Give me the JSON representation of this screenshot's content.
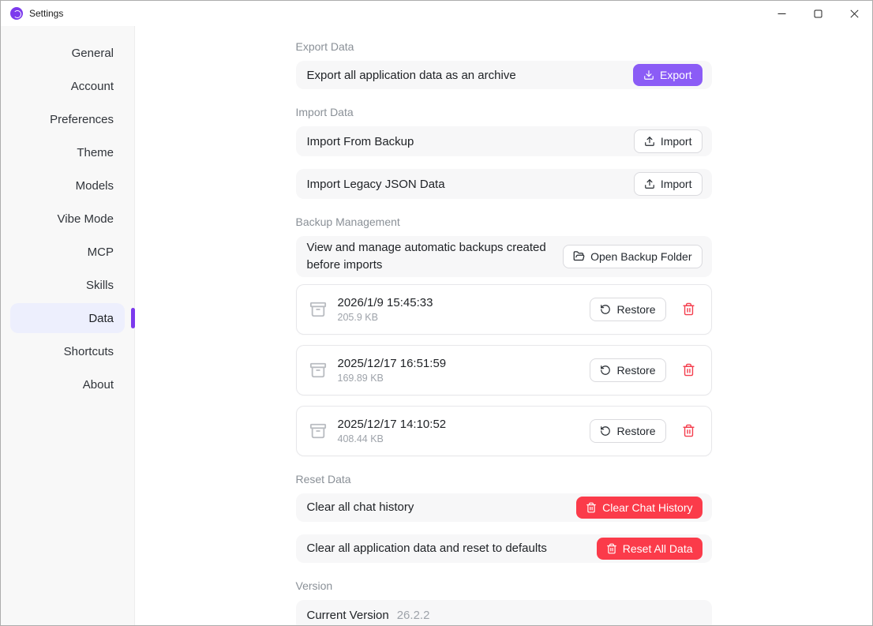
{
  "window": {
    "title": "Settings",
    "controls": {
      "minimize": "minimize",
      "maximize": "maximize",
      "close": "close"
    }
  },
  "colors": {
    "accent_purple": "#8b5cf6",
    "sidebar_accent": "#7c3aed",
    "danger_red": "#fb3b4a",
    "selected_item_bg": "#edeffd"
  },
  "sidebar": {
    "items": [
      {
        "label": "General"
      },
      {
        "label": "Account"
      },
      {
        "label": "Preferences"
      },
      {
        "label": "Theme"
      },
      {
        "label": "Models"
      },
      {
        "label": "Vibe Mode"
      },
      {
        "label": "MCP"
      },
      {
        "label": "Skills"
      },
      {
        "label": "Data"
      },
      {
        "label": "Shortcuts"
      },
      {
        "label": "About"
      }
    ],
    "selected": "Data"
  },
  "sections": {
    "export": {
      "heading": "Export Data",
      "row_label": "Export all application data as an archive",
      "button": "Export"
    },
    "import": {
      "heading": "Import Data",
      "rows": [
        {
          "label": "Import From Backup",
          "button": "Import"
        },
        {
          "label": "Import Legacy JSON Data",
          "button": "Import"
        }
      ]
    },
    "backup": {
      "heading": "Backup Management",
      "description": "View and manage automatic backups created before imports",
      "folder_button": "Open Backup Folder",
      "items": [
        {
          "date": "2026/1/9 15:45:33",
          "size": "205.9 KB",
          "restore": "Restore"
        },
        {
          "date": "2025/12/17 16:51:59",
          "size": "169.89 KB",
          "restore": "Restore"
        },
        {
          "date": "2025/12/17 14:10:52",
          "size": "408.44 KB",
          "restore": "Restore"
        }
      ]
    },
    "reset": {
      "heading": "Reset Data",
      "rows": [
        {
          "label": "Clear all chat history",
          "button": "Clear Chat History"
        },
        {
          "label": "Clear all application data and reset to defaults",
          "button": "Reset All Data"
        }
      ]
    },
    "version": {
      "heading": "Version",
      "label": "Current Version",
      "value": "26.2.2"
    }
  }
}
